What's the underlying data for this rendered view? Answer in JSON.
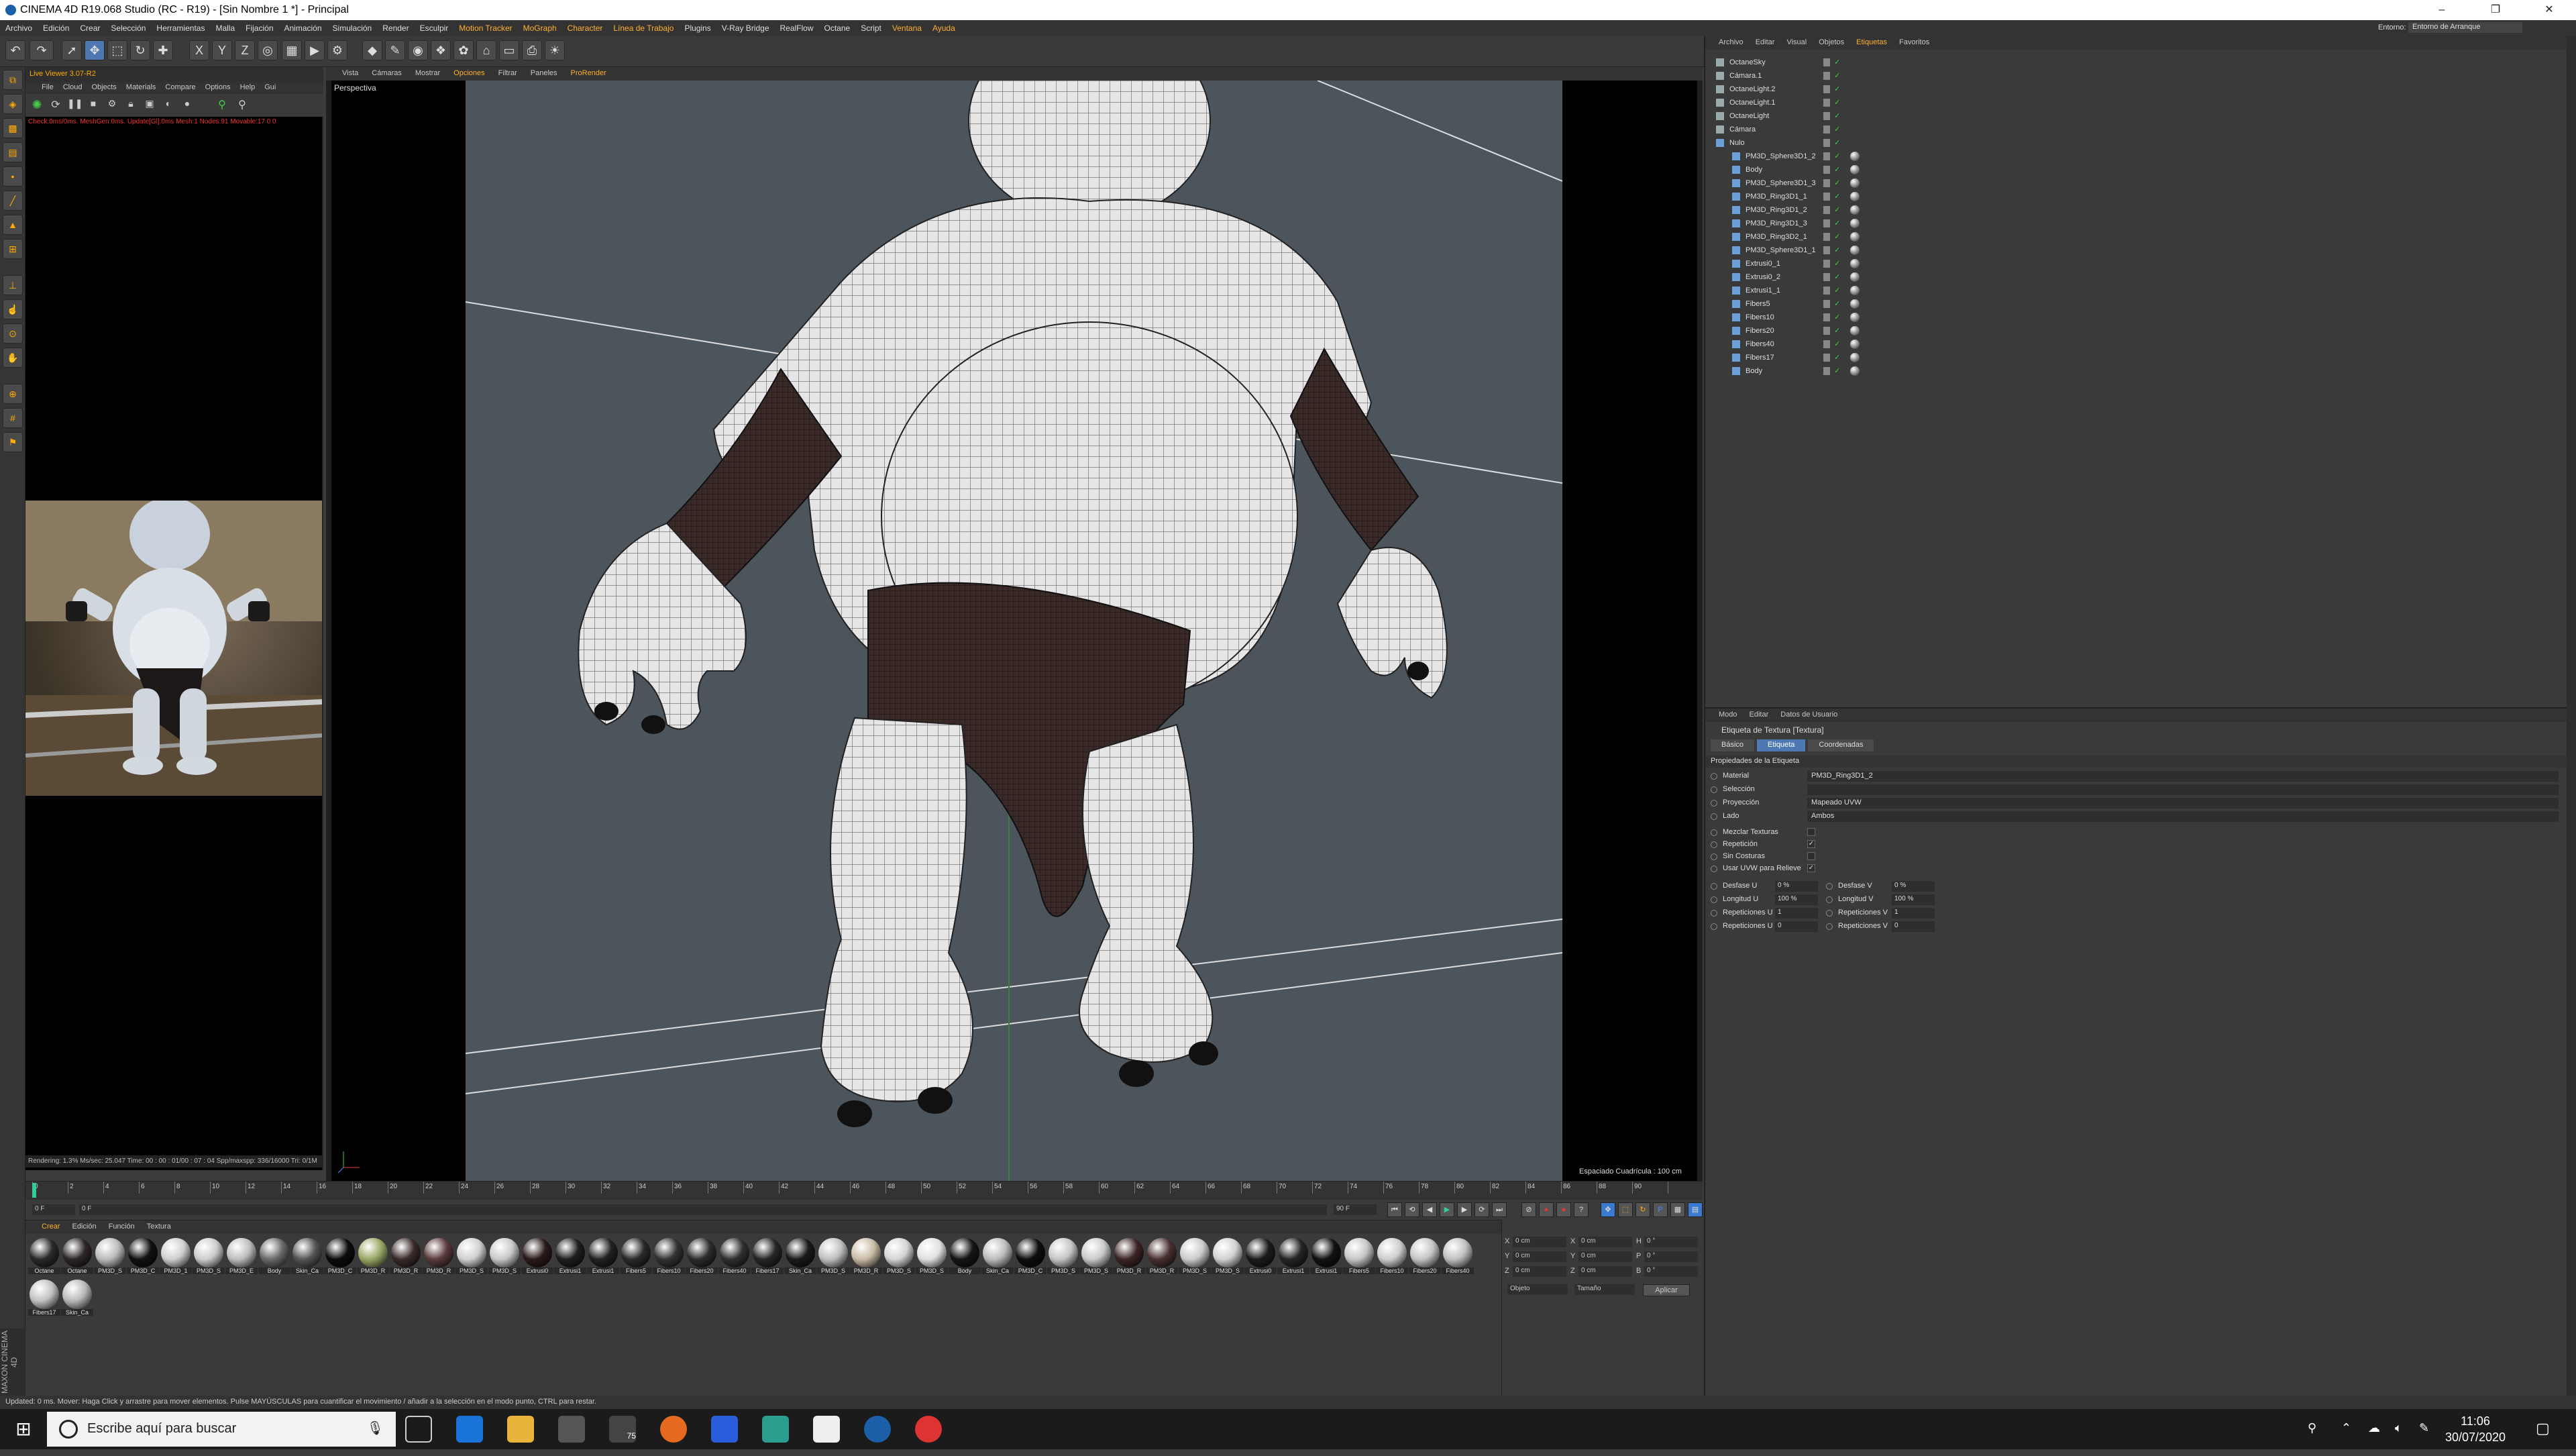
{
  "window": {
    "title": "CINEMA 4D R19.068 Studio (RC - R19) - [Sin Nombre 1 *] - Principal"
  },
  "menu": [
    "Archivo",
    "Edición",
    "Crear",
    "Selección",
    "Herramientas",
    "Malla",
    "Fijación",
    "Animación",
    "Simulación",
    "Render",
    "Esculpir",
    "Motion Tracker",
    "MoGraph",
    "Character",
    "Línea de Trabajo",
    "Plugins",
    "V-Ray Bridge",
    "RealFlow",
    "Octane",
    "Script",
    "Ventana",
    "Ayuda"
  ],
  "layout": {
    "label": "Entorno:",
    "value": "Entorno de Arranque"
  },
  "octane": {
    "title": "Live Viewer 3.07-R2",
    "menu": [
      "File",
      "Cloud",
      "Objects",
      "Materials",
      "Compare",
      "Options",
      "Help",
      "Gui"
    ],
    "status": "Check:0ms/0ms. MeshGen:0ms. Update[Gl]:0ms Mesh:1 Nodes:91 Movable:17 0 0",
    "footer": "Rendering: 1.3%   Ms/sec: 25.047   Time: 00 : 00 : 01/00 : 07 : 04   Spp/maxspp: 336/16000   Tri: 0/1M"
  },
  "viewport": {
    "menu": [
      "Vista",
      "Cámaras",
      "Mostrar",
      "Opciones",
      "Filtrar",
      "Paneles",
      "ProRender"
    ],
    "label": "Perspectiva",
    "spacing": "Espaciado Cuadrícula : 100 cm"
  },
  "timeline": {
    "ticks": [
      "0",
      "2",
      "4",
      "6",
      "8",
      "10",
      "12",
      "14",
      "16",
      "18",
      "20",
      "22",
      "24",
      "26",
      "28",
      "30",
      "32",
      "34",
      "36",
      "38",
      "40",
      "42",
      "44",
      "46",
      "48",
      "50",
      "52",
      "54",
      "56",
      "58",
      "60",
      "62",
      "64",
      "66",
      "68",
      "70",
      "72",
      "74",
      "76",
      "78",
      "80",
      "82",
      "84",
      "86",
      "88",
      "90"
    ],
    "start": "0 F",
    "current": "0 F",
    "end": "90 F",
    "end2": "90 F",
    "frame": "0 F"
  },
  "materials": {
    "menu": [
      "Crear",
      "Edición",
      "Función",
      "Textura"
    ],
    "items": [
      {
        "name": "Octane",
        "color": "#2a2a2a"
      },
      {
        "name": "Octane",
        "color": "#2e2626"
      },
      {
        "name": "PM3D_S",
        "color": "#bbbbbb"
      },
      {
        "name": "PM3D_C",
        "color": "#111111"
      },
      {
        "name": "PM3D_1",
        "color": "#cfcfcf"
      },
      {
        "name": "PM3D_S",
        "color": "#cccccc"
      },
      {
        "name": "PM3D_E",
        "color": "#bdbdbd"
      },
      {
        "name": "Body",
        "color": "#6a6a6a"
      },
      {
        "name": "Skin_Ca",
        "color": "#555555"
      },
      {
        "name": "PM3D_C",
        "color": "#0c0c0c"
      },
      {
        "name": "PM3D_R",
        "color": "#9aa866"
      },
      {
        "name": "PM3D_R",
        "color": "#3a2a2a"
      },
      {
        "name": "PM3D_R",
        "color": "#5a3a3a"
      },
      {
        "name": "PM3D_S",
        "color": "#d0d0d0"
      },
      {
        "name": "PM3D_S",
        "color": "#c8c8c8"
      },
      {
        "name": "Extrusi0",
        "color": "#2a1a1a"
      },
      {
        "name": "Extrusi1",
        "color": "#1e1e1e"
      },
      {
        "name": "Extrusi1",
        "color": "#222222"
      },
      {
        "name": "Fibers5",
        "color": "#2a2a2a"
      },
      {
        "name": "Fibers10",
        "color": "#333333"
      },
      {
        "name": "Fibers20",
        "color": "#2c2c2c"
      },
      {
        "name": "Fibers40",
        "color": "#303030"
      },
      {
        "name": "Fibers17",
        "color": "#262626"
      },
      {
        "name": "Skin_Ca",
        "color": "#1a1a1a"
      },
      {
        "name": "PM3D_S",
        "color": "#c0c0c0"
      },
      {
        "name": "PM3D_R",
        "color": "#c9bba5"
      },
      {
        "name": "PM3D_S",
        "color": "#d4d4d4"
      },
      {
        "name": "PM3D_S",
        "color": "#e0e0e0"
      },
      {
        "name": "Body",
        "color": "#151515"
      },
      {
        "name": "Skin_Ca",
        "color": "#bcbcbc"
      },
      {
        "name": "PM3D_C",
        "color": "#0e0e0e"
      },
      {
        "name": "PM3D_S",
        "color": "#c5c5c5"
      },
      {
        "name": "PM3D_S",
        "color": "#cacaca"
      },
      {
        "name": "PM3D_R",
        "color": "#3c2424"
      },
      {
        "name": "PM3D_R",
        "color": "#4a3030"
      },
      {
        "name": "PM3D_S",
        "color": "#cbcbcb"
      },
      {
        "name": "PM3D_S",
        "color": "#d2d2d2"
      },
      {
        "name": "Extrusi0",
        "color": "#1c1c1c"
      },
      {
        "name": "Extrusi1",
        "color": "#252525"
      },
      {
        "name": "Extrusi1",
        "color": "#121212"
      },
      {
        "name": "Fibers5",
        "color": "#c6c6c6"
      },
      {
        "name": "Fibers10",
        "color": "#cecece"
      },
      {
        "name": "Fibers20",
        "color": "#c4c4c4"
      },
      {
        "name": "Fibers40",
        "color": "#bfbfbf"
      },
      {
        "name": "Fibers17",
        "color": "#c1c1c1"
      },
      {
        "name": "Skin_Ca",
        "color": "#b8b8b8"
      }
    ]
  },
  "coords": {
    "apply": "Aplicar",
    "rows": [
      {
        "a": "X",
        "v1": "0 cm",
        "b": "X",
        "v2": "0 cm",
        "c": "H",
        "v3": "0 °"
      },
      {
        "a": "Y",
        "v1": "0 cm",
        "b": "Y",
        "v2": "0 cm",
        "c": "P",
        "v3": "0 °"
      },
      {
        "a": "Z",
        "v1": "0 cm",
        "b": "Z",
        "v2": "0 cm",
        "c": "B",
        "v3": "0 °"
      }
    ],
    "drop1": "Objeto",
    "drop2": "Tamaño"
  },
  "objects": {
    "tabs": [
      "Archivo",
      "Editar",
      "Visual",
      "Objetos",
      "Etiquetas",
      "Favoritos"
    ],
    "rows": [
      "OctaneSky",
      "Cámara.1",
      "OctaneLight.2",
      "OctaneLight.1",
      "OctaneLight",
      "Cámara",
      "Nulo",
      "PM3D_Sphere3D1_2",
      "Body",
      "PM3D_Sphere3D1_3",
      "PM3D_Ring3D1_1",
      "PM3D_Ring3D1_2",
      "PM3D_Ring3D1_3",
      "PM3D_Ring3D2_1",
      "PM3D_Sphere3D1_1",
      "Extrusi0_1",
      "Extrusi0_2",
      "Extrusi1_1",
      "Fibers5",
      "Fibers10",
      "Fibers20",
      "Fibers40",
      "Fibers17",
      "Body"
    ]
  },
  "attributes": {
    "menu": [
      "Modo",
      "Editar",
      "Datos de Usuario"
    ],
    "title": "Etiqueta de Textura [Textura]",
    "tabs": [
      "Básico",
      "Etiqueta",
      "Coordenadas"
    ],
    "section": "Propiedades de la Etiqueta",
    "material_label": "Material",
    "material": "PM3D_Ring3D1_2",
    "selection_label": "Selección",
    "projection_label": "Proyección",
    "projection": "Mapeado UVW",
    "side_label": "Lado",
    "side": "Ambos",
    "mix_label": "Mezclar Texturas",
    "tile_label": "Repetición",
    "seamless_label": "Sin Costuras",
    "uvw_label": "Usar UVW para Relieve",
    "offu_label": "Desfase U",
    "offu": "0 %",
    "offv_label": "Desfase V",
    "offv": "0 %",
    "lenu_label": "Longitud U",
    "lenu": "100 %",
    "lenv_label": "Longitud V",
    "lenv": "100 %",
    "repu_label": "Repeticiones U",
    "repu": "1",
    "repv_label": "Repeticiones V",
    "repv": "1",
    "repu2_label": "Repeticiones U",
    "repu2": "0",
    "repv2_label": "Repeticiones V",
    "repv2": "0"
  },
  "statusbar": "Updated: 0 ms.     Mover: Haga Click y arrastre para mover elementos. Pulse MAYÚSCULAS para cuantificar el movimiento / añadir a la selección en el modo punto, CTRL para restar.",
  "taskbar": {
    "search": "Escribe aquí para buscar",
    "time": "11:06",
    "date": "30/07/2020",
    "badge": "75"
  },
  "maxon": "MAXON CINEMA 4D"
}
